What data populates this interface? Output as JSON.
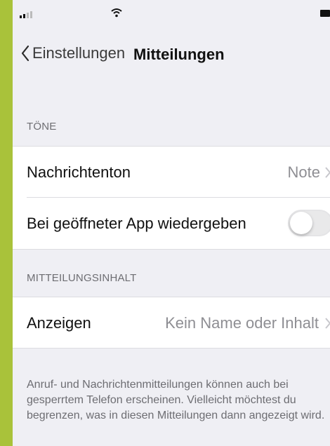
{
  "nav": {
    "back_label": "Einstellungen",
    "title": "Mitteilungen"
  },
  "sections": {
    "toene_header": "TÖNE",
    "inhalt_header": "MITTEILUNGSINHALT"
  },
  "rows": {
    "nachrichtenton": {
      "label": "Nachrichtenton",
      "value": "Note"
    },
    "bei_geoeffneter_app": {
      "label": "Bei geöffneter App wiedergeben",
      "toggle_on": false
    },
    "anzeigen": {
      "label": "Anzeigen",
      "value": "Kein Name oder Inhalt"
    }
  },
  "footer": {
    "text": "Anruf- und Nachrichtenmitteilungen können auch bei gesperrtem Telefon erscheinen. Vielleicht möchtest du begrenzen, was in diesen Mitteilungen dann angezeigt wird."
  },
  "colors": {
    "background_border": "#a9c23a",
    "grouped_background": "#efeff4",
    "secondary_text": "#8e8e93"
  },
  "icons": {
    "signal": "cellular-signal-icon",
    "wifi": "wifi-icon",
    "battery": "battery-icon",
    "back": "chevron-left-icon",
    "disclosure": "chevron-right-icon"
  }
}
